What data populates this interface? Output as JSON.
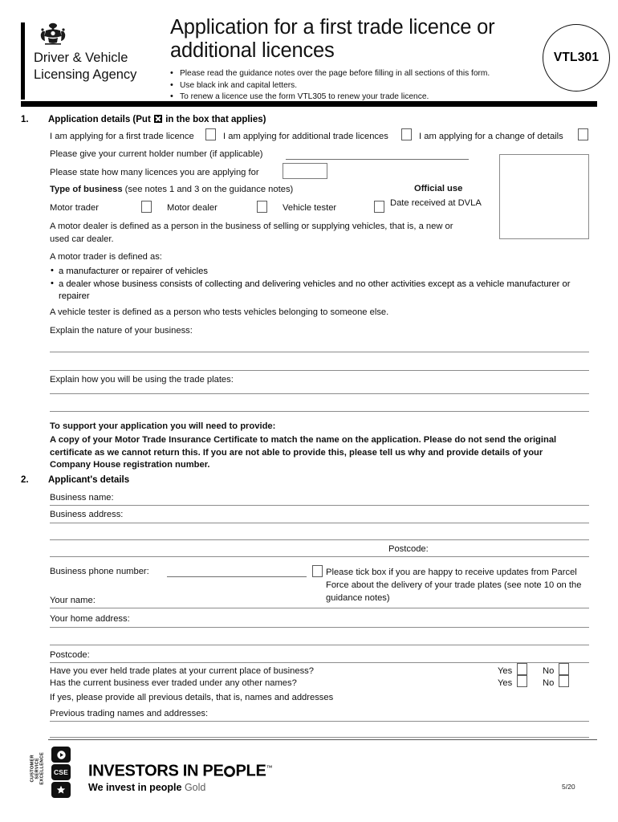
{
  "header": {
    "brand_name": "Driver & Vehicle Licensing Agency",
    "crest_icon": "royal-coat-of-arms-icon",
    "title": "Application for a first trade licence or additional licences",
    "form_code": "VTL301",
    "bullets": [
      "Please read the guidance notes over the page before filling in all sections of this form.",
      "Use black ink and capital letters.",
      "To renew a licence use the form VTL305 to renew your trade licence."
    ]
  },
  "section1": {
    "number": "1.",
    "heading_pre": "Application details (Put",
    "heading_post": "in the box that applies)",
    "options": [
      "I am applying for a first trade licence",
      "I am applying for additional trade licences",
      "I am applying for a change of details"
    ],
    "holder_number_label": "Please give your current holder number (if applicable)",
    "holder_number_value": "",
    "how_many_label": "Please state how many licences you are applying for",
    "how_many_value": "",
    "type_of_business_bold": "Type of business",
    "type_of_business_note": "(see notes 1 and 3 on the guidance notes)",
    "business_types": [
      "Motor trader",
      "Motor dealer",
      "Vehicle tester"
    ],
    "official_use_label": "Official use",
    "date_received_label": "Date received at DVLA",
    "date_received_value": "",
    "dealer_def": "A motor dealer is defined as a person in the business of selling or supplying vehicles, that is, a new or used car dealer.",
    "trader_def_lead": "A motor trader is defined as:",
    "trader_def_bullets": [
      "a manufacturer or repairer of vehicles",
      "a dealer whose business consists of collecting and delivering vehicles and no other activities except as a vehicle manufacturer or repairer"
    ],
    "tester_def": "A vehicle tester is defined as a person who tests vehicles belonging to someone else.",
    "nature_label": "Explain the nature of your business:",
    "nature_value": "",
    "plates_label": "Explain how you will be using the trade plates:",
    "plates_value": "",
    "support_heading": "To support your application you will need to provide:",
    "support_body": "A copy of your Motor Trade Insurance Certificate to match the name on the application. Please do not send the original certificate as we cannot return this. If you are not able to provide this, please tell us why and provide details of your Company House registration number."
  },
  "section2": {
    "number": "2.",
    "heading": "Applicant's details",
    "business_name_label": "Business name:",
    "business_name_value": "",
    "business_address_label": "Business address:",
    "business_address_value": "",
    "postcode_label": "Postcode:",
    "business_postcode_value": "",
    "phone_label": "Business phone number:",
    "phone_value": "",
    "parcelforce_text": "Please tick box if you are happy to receive updates from Parcel Force about the delivery of your trade plates (see note 10 on the guidance notes)",
    "your_name_label": "Your name:",
    "your_name_value": "",
    "home_address_label": "Your home address:",
    "home_address_value": "",
    "home_postcode_label": "Postcode:",
    "home_postcode_value": "",
    "questions": [
      "Have you ever held trade plates at your current place of business?",
      "Has the current business ever traded under any other names?"
    ],
    "yes_label": "Yes",
    "no_label": "No",
    "if_yes_text": "If yes, please provide all previous details, that is, names and addresses",
    "previous_label": "Previous trading names and addresses:",
    "previous_value": ""
  },
  "footer": {
    "cse_text": "CUSTOMER SERVICE EXCELLENCE",
    "cse_badge_label": "CSE",
    "play_icon": "play-triangle-icon",
    "star_icon": "star-icon",
    "iip_title_a": "INVESTORS IN PE",
    "iip_title_b": "PLE",
    "iip_tm": "™",
    "iip_tagline": "We invest in people",
    "iip_level": "Gold",
    "page_number": "5/20"
  }
}
